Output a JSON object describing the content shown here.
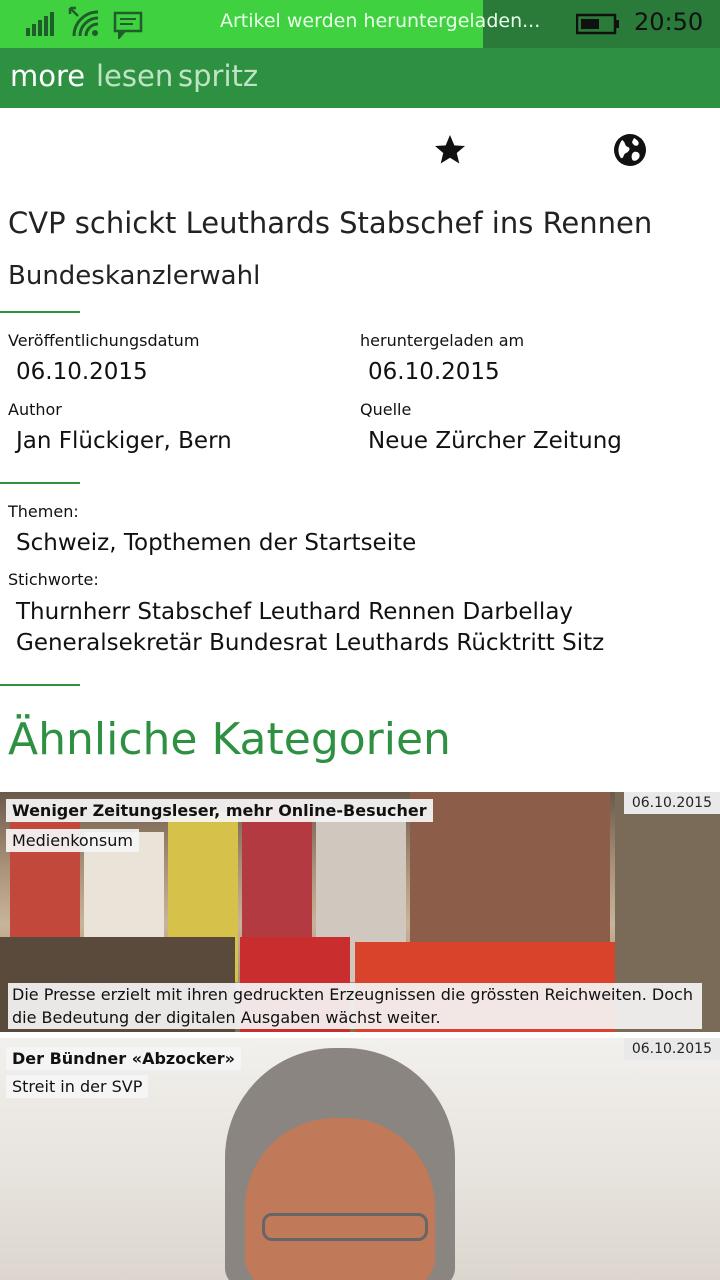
{
  "status_bar": {
    "message": "Artikel werden heruntergeladen...",
    "time": "20:50",
    "signal_icon": "signal-bars-icon",
    "wifi_icon": "wifi-icon",
    "message_icon": "message-icon",
    "battery_icon": "battery-icon"
  },
  "pivot": {
    "tabs": [
      {
        "label": "more",
        "active": true
      },
      {
        "label": "lesen",
        "active": false
      },
      {
        "label": "spritz",
        "active": false
      }
    ]
  },
  "actions": {
    "favorite_icon": "star-icon",
    "browser_icon": "globe-icon"
  },
  "article": {
    "title": "CVP schickt Leuthards Stabschef ins Rennen",
    "subtitle": "Bundeskanzlerwahl",
    "published_label": "Veröffentlichungsdatum",
    "published_value": "06.10.2015",
    "downloaded_label": "heruntergeladen am",
    "downloaded_value": "06.10.2015",
    "author_label": "Author",
    "author_value": "Jan Flückiger, Bern",
    "source_label": "Quelle",
    "source_value": "Neue Zürcher Zeitung",
    "topics_label": "Themen:",
    "topics_value": "Schweiz, Topthemen der Startseite",
    "keywords_label": "Stichworte:",
    "keywords_line1": "Thurnherr Stabschef Leuthard Rennen Darbellay",
    "keywords_line2": "Generalsekretär Bundesrat Leuthards Rücktritt Sitz"
  },
  "related": {
    "heading": "Ähnliche Kategorien",
    "cards": [
      {
        "title": "Weniger Zeitungsleser, mehr Online-Besucher",
        "category": "Medienkonsum",
        "date": "06.10.2015",
        "description": "Die Presse erzielt mit ihren gedruckten Erzeugnissen die grössten Reichweiten. Doch die Bedeutung der digitalen Ausgaben wächst weiter."
      },
      {
        "title": "Der Bündner «Abzocker»",
        "category": "Streit in der SVP",
        "date": "06.10.2015"
      }
    ]
  },
  "colors": {
    "accent": "#2e9142",
    "status_bar": "#3fd13f",
    "heading": "#2e9142"
  }
}
